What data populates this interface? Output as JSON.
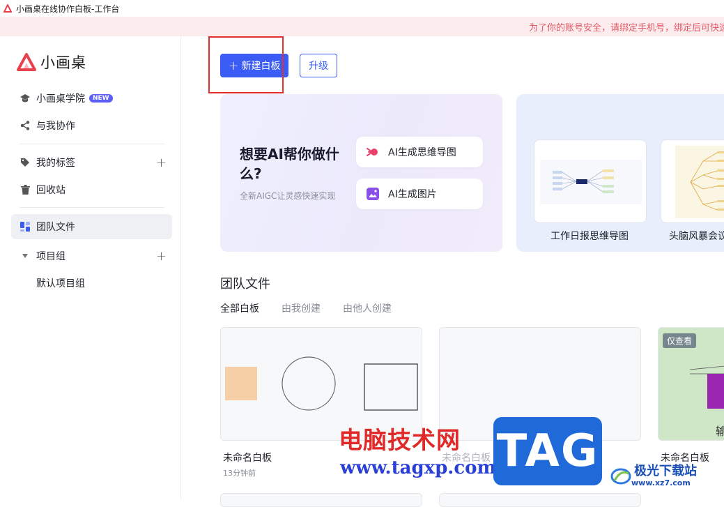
{
  "window": {
    "title": "小画桌在线协作白板-工作台"
  },
  "banner": {
    "text": "为了你的账号安全，请绑定手机号，绑定后可快速"
  },
  "brand": {
    "name": "小画桌",
    "color": "#e8414e"
  },
  "sidebar": {
    "academy": {
      "label": "小画桌学院",
      "badge": "NEW"
    },
    "collab": {
      "label": "与我协作"
    },
    "tags": {
      "label": "我的标签"
    },
    "trash": {
      "label": "回收站"
    },
    "team_files": {
      "label": "团队文件"
    },
    "project_group": {
      "label": "项目组"
    },
    "default_group": {
      "label": "默认项目组"
    }
  },
  "toolbar": {
    "new_board_label": "新建白板",
    "upgrade_label": "升级"
  },
  "ai_card": {
    "title": "想要AI帮你做什么?",
    "subtitle": "全新AIGC让灵感快速实现",
    "mindmap_label": "AI生成思维导图",
    "image_label": "AI生成图片"
  },
  "templates": [
    {
      "label": "工作日报思维导图"
    },
    {
      "label": "头脑风暴会议"
    }
  ],
  "files_section": {
    "title": "团队文件",
    "tabs": [
      "全部白板",
      "由我创建",
      "由他人创建"
    ],
    "files": [
      {
        "name": "未命名白板",
        "time": "13分钟前"
      },
      {
        "name": "未命名白板",
        "time": ""
      },
      {
        "name": "未命名白板",
        "time": "",
        "badge": "仅查看"
      }
    ]
  },
  "watermarks": {
    "site_cn": "电脑技术网",
    "site_url": "www.tagxp.com",
    "tag": "TAG",
    "brand2": "极光下载站",
    "brand2_url": "www.xz7.com"
  },
  "colors": {
    "accent": "#3a5cf5",
    "highlight": "#e03030",
    "banner_text": "#e05a66"
  }
}
